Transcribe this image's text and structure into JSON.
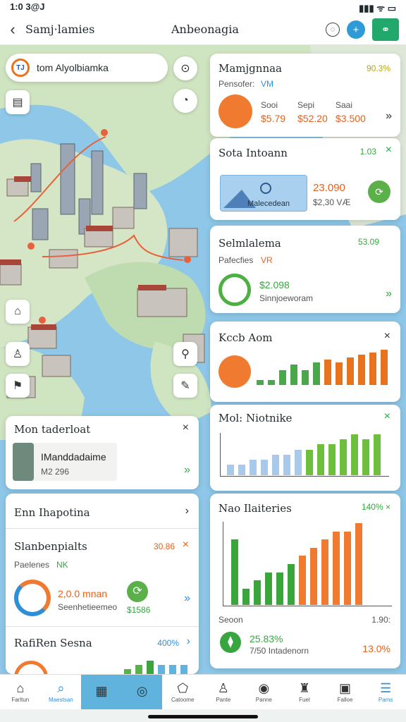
{
  "status": {
    "time": "1:0 3@J",
    "icons": "▮▮▮ ᯤ ▭"
  },
  "header": {
    "back": "‹",
    "title": "Samj·lamies",
    "subtitle": "Anbeonagia"
  },
  "search": {
    "logo": "TJ",
    "text": "tom Alyolbiamka"
  },
  "cards": {
    "c1": {
      "title": "Mamjgnnaa",
      "pct": "90.3%",
      "sub": "Pensofer:",
      "sub_tag": "VM",
      "cols": [
        {
          "label": "Sooi",
          "value": "$5.79"
        },
        {
          "label": "Sepi",
          "value": "$52.20"
        },
        {
          "label": "Saai",
          "value": "$3.500"
        }
      ]
    },
    "c2": {
      "title": "Sota Intoann",
      "pct": "1.03",
      "thumb_label": "Malecedean",
      "value": "23.090",
      "sub": "$2,30 VÆ"
    },
    "c3": {
      "title": "Selmlalema",
      "pct": "53.09",
      "sub": "Pafecfies",
      "sub_tag": "VR",
      "value": "$2.098",
      "sub2": "Sinnjoeworam"
    },
    "c4": {
      "title": "Kccb Aom"
    },
    "c5": {
      "title": "Mol: Niotnike"
    },
    "c6": {
      "title": "Nao Ilaiteries",
      "pct": "140% ×",
      "footer_left": "Seoon",
      "footer_right": "1.90:",
      "stat_value": "25.83%",
      "stat_label": "7/50 Intadenorn",
      "stat_right": "13.0%"
    },
    "popup": {
      "title": "Mon taderloat",
      "name": "IManddadaime",
      "value": "M2 296"
    },
    "list": {
      "title": "Enn Ihapotina",
      "item_title": "Slanbenpialts",
      "item_value": "30.86",
      "item_sub": "Paelenes",
      "item_tag": "NK",
      "stat_value": "2,0.0 mnan",
      "stat_label": "Seenhetieemeo",
      "badge": "$1586"
    },
    "list2": {
      "title": "RafiRen Sesna",
      "pct": "400%"
    }
  },
  "tabs": [
    {
      "icon": "⌂",
      "label": "Farltun"
    },
    {
      "icon": "⌕",
      "label": "Maestsan"
    },
    {
      "icon": "▦",
      "label": ""
    },
    {
      "icon": "◎",
      "label": ""
    },
    {
      "icon": "⬠",
      "label": "Catoome"
    },
    {
      "icon": "♙",
      "label": "Pante"
    },
    {
      "icon": "◉",
      "label": "Panne"
    },
    {
      "icon": "♜",
      "label": "Fuel"
    },
    {
      "icon": "▣",
      "label": "Falloe"
    },
    {
      "icon": "☰",
      "label": "Pams"
    }
  ],
  "chart_data": [
    {
      "type": "bar",
      "title": "Kccb Aom",
      "series": [
        {
          "values": [
            2,
            2,
            6,
            8,
            6,
            9,
            10,
            9,
            11,
            12,
            13,
            14
          ]
        }
      ],
      "colors": [
        "#4aa84a",
        "#e8731f"
      ]
    },
    {
      "type": "bar",
      "title": "Mol: Niotnike",
      "series": [
        {
          "values": [
            2,
            2,
            3,
            3,
            4,
            4,
            5,
            5,
            6,
            6,
            7,
            8,
            7,
            8
          ]
        }
      ],
      "colors": [
        "#a8c9ea",
        "#6fbf3f"
      ]
    },
    {
      "type": "bar",
      "title": "Nao Ilaiteries",
      "series": [
        {
          "values": [
            8,
            2,
            3,
            4,
            4,
            5,
            6,
            7,
            8,
            9,
            9,
            10
          ]
        }
      ],
      "colors": [
        "#3aa53a",
        "#f07a30"
      ]
    }
  ],
  "colors": {
    "accent": "#2f9bd6",
    "brand": "#23a86b",
    "orange": "#e8601c",
    "green": "#37a640",
    "water": "#8ec7e8",
    "land": "#cfe4c0"
  }
}
